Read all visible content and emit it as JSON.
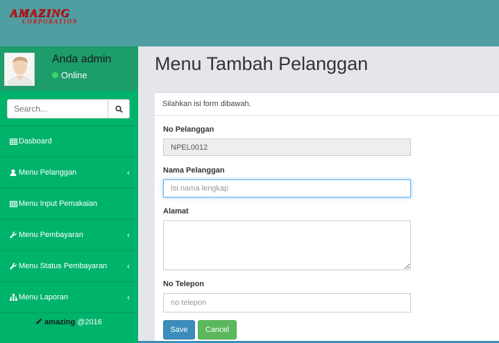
{
  "brand": {
    "line1": "AMAZING",
    "line2": "CORPORATION"
  },
  "user": {
    "name": "Anda admin",
    "status": "Online"
  },
  "search": {
    "placeholder": "Search..."
  },
  "sidebar": {
    "items": [
      {
        "label": "Dasboard",
        "icon": "table-icon",
        "has_caret": false
      },
      {
        "label": "Menu Pelanggan",
        "icon": "user-icon",
        "has_caret": true
      },
      {
        "label": "Menu Input Pemakaian",
        "icon": "table-icon",
        "has_caret": false
      },
      {
        "label": "Menu Pembayaran",
        "icon": "wrench-icon",
        "has_caret": true
      },
      {
        "label": "Menu Status Pembayaran",
        "icon": "wrench-icon",
        "has_caret": true
      },
      {
        "label": "Menu Laporan",
        "icon": "sitemap-icon",
        "has_caret": true
      }
    ],
    "footer_brand": "amazing",
    "footer_year": "@2016"
  },
  "page": {
    "title": "Menu Tambah Pelanggan",
    "instruction": "Silahkan isi form dibawah."
  },
  "form": {
    "no_pelanggan": {
      "label": "No Pelanggan",
      "value": "NPEL0012"
    },
    "nama_pelanggan": {
      "label": "Nama Pelanggan",
      "placeholder": "Isi nama lengkap"
    },
    "alamat": {
      "label": "Alamat",
      "value": ""
    },
    "no_telepon": {
      "label": "No Telepon",
      "placeholder": "no telepon"
    },
    "save_label": "Save",
    "cancel_label": "Cancel"
  },
  "colors": {
    "topbar": "#4f9ea2",
    "sidebar": "#00b36b",
    "user_panel": "#1c9d69",
    "brand_red": "#c9131a",
    "save": "#3c8dbc",
    "cancel": "#5cb85c"
  }
}
